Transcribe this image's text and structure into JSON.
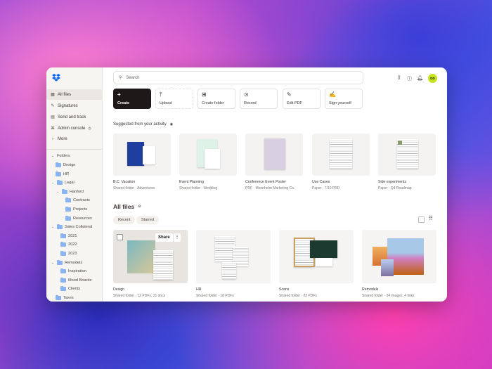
{
  "sidebar": {
    "nav": [
      {
        "label": "All files",
        "icon": "files-icon"
      },
      {
        "label": "Signatures",
        "icon": "signature-icon"
      },
      {
        "label": "Send and track",
        "icon": "send-icon"
      },
      {
        "label": "Admin console",
        "icon": "admin-icon"
      },
      {
        "label": "More",
        "icon": "chevron-right-icon"
      }
    ],
    "folders_label": "Folders",
    "tree": [
      "Design",
      "HR",
      "Legal",
      "Hanford",
      "Contracts",
      "Projects",
      "Resources",
      "Sales Collateral",
      "2021",
      "2022",
      "2023",
      "Remodels",
      "Inspiration",
      "Mood Boards",
      "Clients",
      "Taxes"
    ]
  },
  "search": {
    "placeholder": "Search"
  },
  "user": {
    "initials": "DD",
    "avatar_color": "#c5e41e"
  },
  "actions": [
    "Create",
    "Upload",
    "Create folder",
    "Record",
    "Edit PDF",
    "Sign yourself"
  ],
  "suggested": {
    "title": "Suggested from your activity",
    "items": [
      {
        "name": "B.C. Vacation",
        "meta": "Shared folder · Adventures"
      },
      {
        "name": "Event Planning",
        "meta": "Shared folder · Wedding"
      },
      {
        "name": "Conference Event Poster",
        "meta": "PDF · Moonhelm Marketing Co."
      },
      {
        "name": "Use Cases",
        "meta": "Paper · 7/10 PRD"
      },
      {
        "name": "Side experiments",
        "meta": "Paper · Q4 Roadmap"
      }
    ]
  },
  "all_files": {
    "title": "All files",
    "filters": [
      "Recent",
      "Starred"
    ],
    "share_label": "Share",
    "items": [
      {
        "name": "Design",
        "meta": "Shared folder · 12 PDFs, 21 docs"
      },
      {
        "name": "HR",
        "meta": "Shared folder · 18 PDFs"
      },
      {
        "name": "Scans",
        "meta": "Shared folder · 22 PDFs"
      },
      {
        "name": "Remodels",
        "meta": "Shared folder · 34 images, 4 links"
      }
    ]
  }
}
